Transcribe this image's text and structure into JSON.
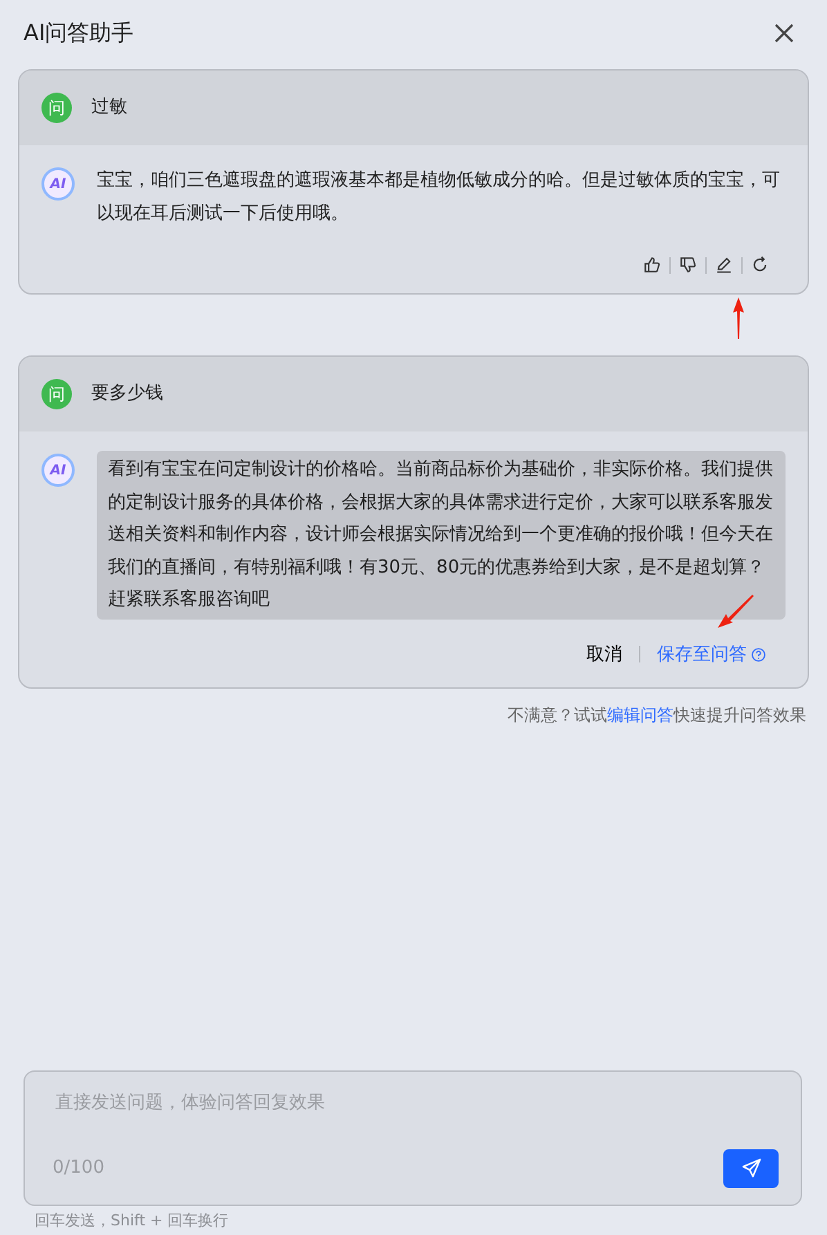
{
  "window": {
    "title": "AI问答助手"
  },
  "conversations": [
    {
      "avatar": "问",
      "question": "过敏",
      "ai_badge": "AI",
      "answer": "宝宝，咱们三色遮瑕盘的遮瑕液基本都是植物低敏成分的哈。但是过敏体质的宝宝，可以现在耳后测试一下后使用哦。",
      "kind": "view",
      "annotated": true
    },
    {
      "avatar": "问",
      "question": "要多少钱",
      "ai_badge": "AI",
      "answer": "看到有宝宝在问定制设计的价格哈。当前商品标价为基础价，非实际价格。我们提供的定制设计服务的具体价格，会根据大家的具体需求进行定价，大家可以联系客服发送相关资料和制作内容，设计师会根据实际情况给到一个更准确的报价哦！但今天在我们的直播间，有特别福利哦！有30元、80元的优惠券给到大家，是不是超划算？赶紧联系客服咨询吧",
      "kind": "editing",
      "annotated": true,
      "cancel_label": "取消",
      "save_label": "保存至问答"
    }
  ],
  "feedback_hint": {
    "before": "不满意？试试",
    "link": "编辑问答",
    "after": "快速提升问答效果"
  },
  "composer": {
    "placeholder": "直接发送问题，体验问答回复效果",
    "counter": "0/100"
  },
  "shortcut_hint": "回车发送，Shift + 回车换行"
}
